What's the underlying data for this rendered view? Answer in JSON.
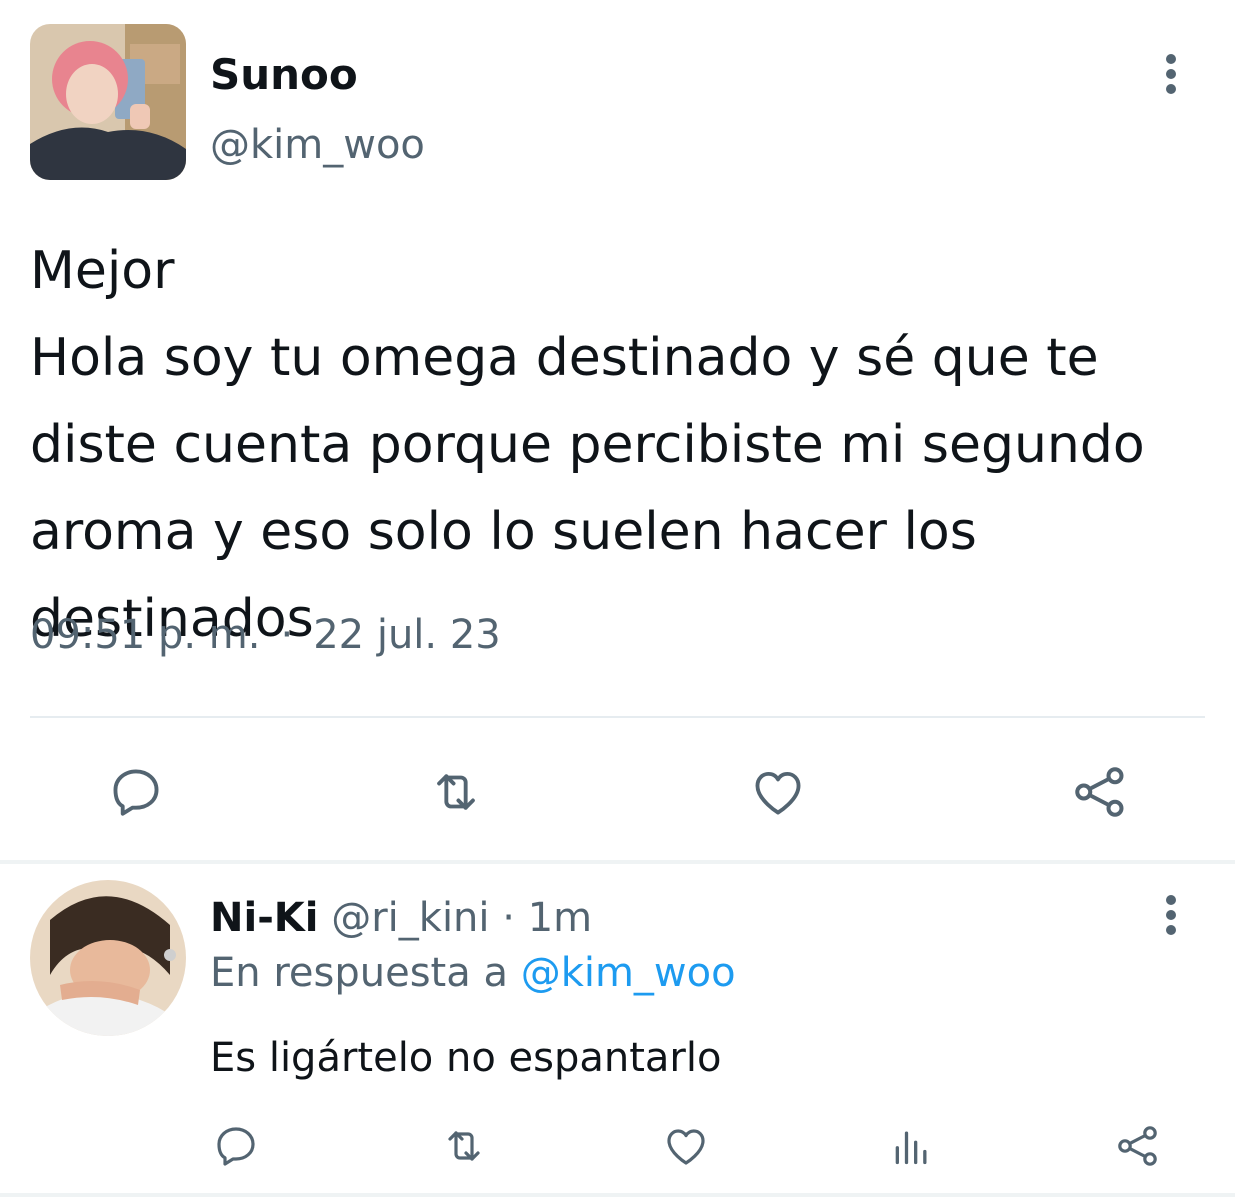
{
  "tweet": {
    "display_name": "Sunoo",
    "handle": "@kim_woo",
    "text": "Mejor\nHola soy tu omega destinado y sé que te diste cuenta porque percibiste mi segundo aroma y eso solo lo suelen hacer los destinados",
    "time": "09:51 p. m.",
    "separator": "·",
    "date": "22 jul. 23",
    "actions": [
      "reply-icon",
      "retweet-icon",
      "like-icon",
      "share-icon"
    ]
  },
  "reply": {
    "display_name": "Ni-Ki",
    "handle": "@ri_kini",
    "separator": "·",
    "age": "1m",
    "in_reply_prefix": "En respuesta a",
    "in_reply_handle": "@kim_woo",
    "text": "Es ligártelo no espantarlo",
    "actions": [
      "reply-icon",
      "retweet-icon",
      "like-icon",
      "views-icon",
      "share-icon"
    ]
  },
  "colors": {
    "text": "#0f1419",
    "secondary": "#536471",
    "link": "#1d9bf0",
    "divider": "#e6ecf0"
  }
}
